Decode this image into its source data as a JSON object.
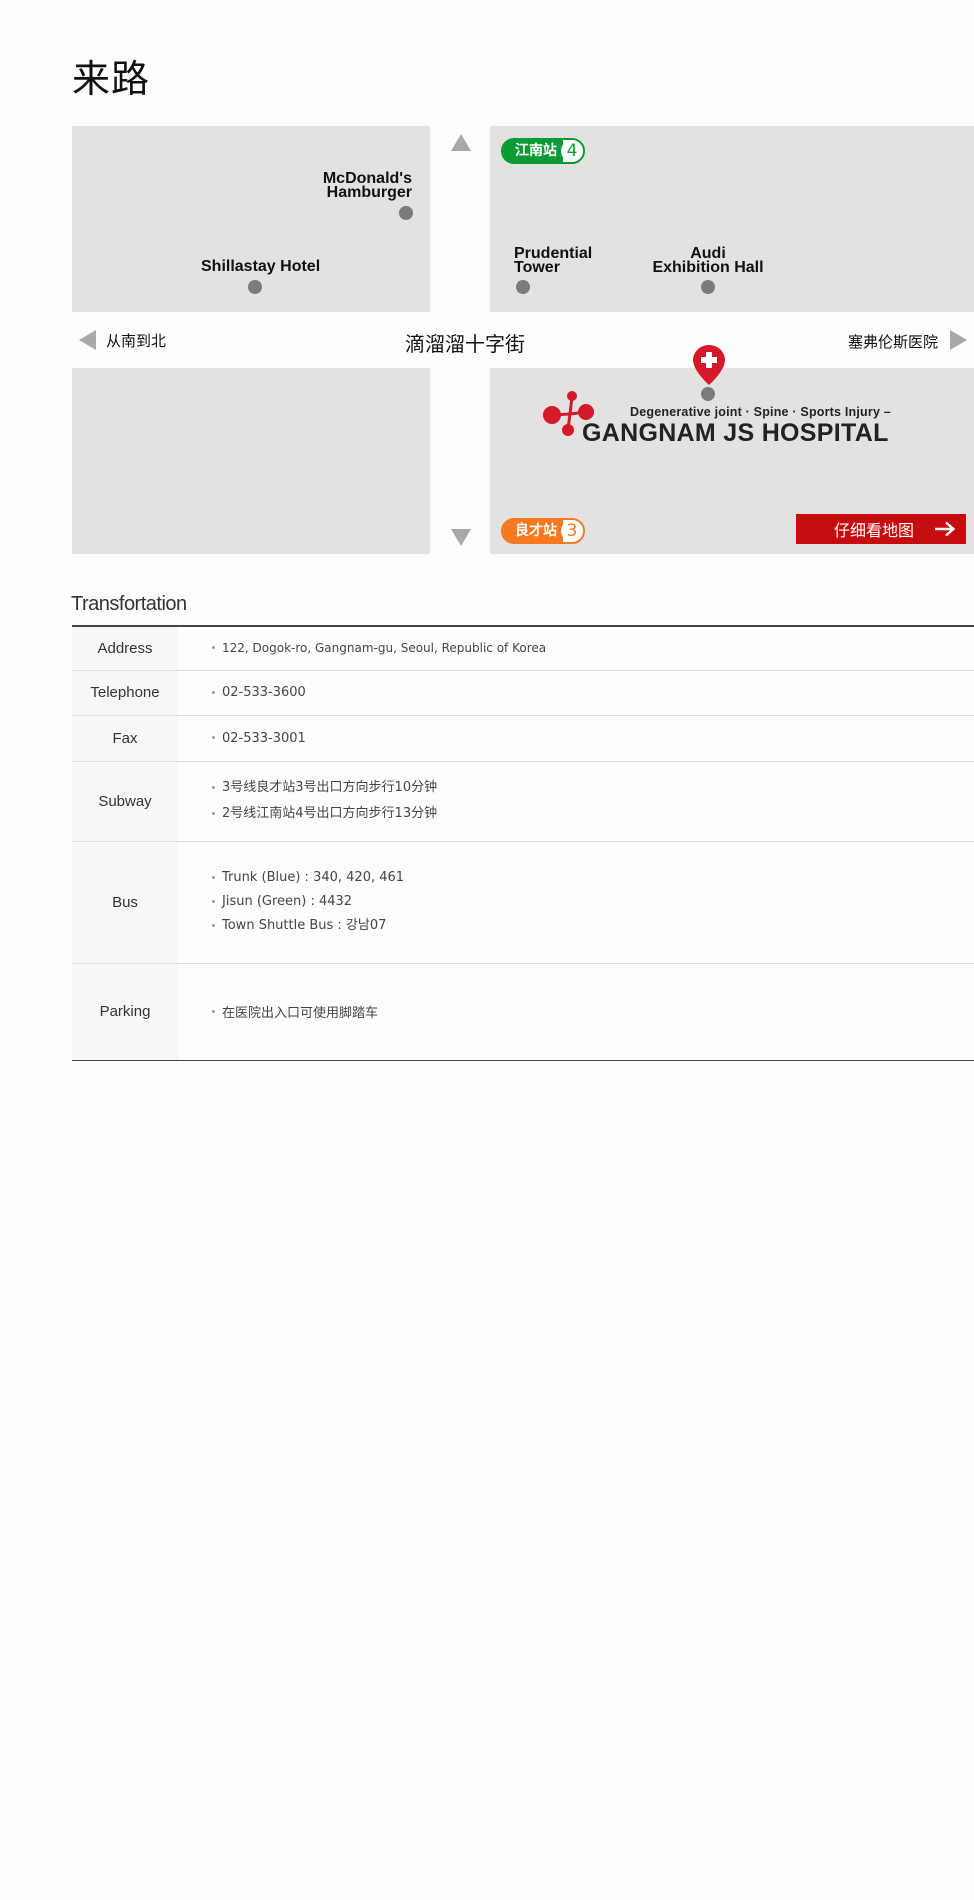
{
  "page": {
    "title": "来路"
  },
  "map": {
    "direction_left": "从南到北",
    "street_name": "滴溜溜十字街",
    "direction_right": "塞弗伦斯医院",
    "landmarks": {
      "mcdonalds_line1": "McDonald's",
      "mcdonalds_line2": "Hamburger",
      "shillastay": "Shillastay Hotel",
      "prudential_line1": "Prudential",
      "prudential_line2": "Tower",
      "audi_line1": "Audi",
      "audi_line2": "Exhibition Hall"
    },
    "station_gangnam": {
      "name": "江南站",
      "exit": "4",
      "color": "#0a9a36"
    },
    "station_yangjae": {
      "name": "良才站",
      "exit": "3",
      "color": "#f47920"
    },
    "hospital": {
      "subtitle": "Degenerative joint · Spine · Sports Injury –",
      "name": "GANGNAM JS HOSPITAL",
      "brand_color": "#d41a2a"
    },
    "detail_button": {
      "label": "仔细看地图",
      "icon": "arrow-right-icon"
    }
  },
  "transportation": {
    "title": "Transfortation",
    "rows": [
      {
        "label": "Address",
        "values": [
          "122, Dogok-ro, Gangnam-gu, Seoul, Republic of Korea"
        ]
      },
      {
        "label": "Telephone",
        "values": [
          "02-533-3600"
        ]
      },
      {
        "label": "Fax",
        "values": [
          "02-533-3001"
        ]
      },
      {
        "label": "Subway",
        "values": [
          "3号线良才站3号出口方向步行10分钟",
          "2号线江南站4号出口方向步行13分钟"
        ]
      },
      {
        "label": "Bus",
        "values": [
          "Trunk (Blue) : 340, 420, 461",
          "Jisun (Green) : 4432",
          "Town Shuttle Bus : 강남07"
        ]
      },
      {
        "label": "Parking",
        "values": [
          "在医院出入口可使用脚踏车"
        ]
      }
    ]
  }
}
